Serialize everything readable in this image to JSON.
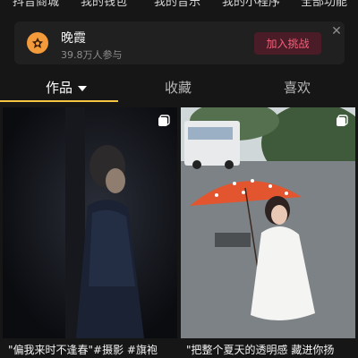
{
  "top_menu": [
    "抖音商城",
    "我的钱包",
    "我的音乐",
    "我的小程序",
    "全部功能"
  ],
  "challenge": {
    "title": "晚霞",
    "participants": "39.8万人参与",
    "join_label": "加入挑战",
    "icon": "fire-badge-icon",
    "close_icon": "close-icon"
  },
  "tabs": [
    {
      "label": "作品",
      "active": true,
      "has_dropdown": true
    },
    {
      "label": "收藏",
      "active": false
    },
    {
      "label": "喜欢",
      "active": false
    }
  ],
  "colors": {
    "accent": "#f5c542",
    "join_bg": "#4a1c27",
    "join_text": "#f4607a",
    "background": "#161616"
  },
  "videos": [
    {
      "caption": "\"偏我来时不逢春\"#摄影 #旗袍",
      "icon": "multi-image-icon"
    },
    {
      "caption": "\"把整个夏天的透明感 藏进你扬",
      "icon": "multi-image-icon"
    }
  ]
}
